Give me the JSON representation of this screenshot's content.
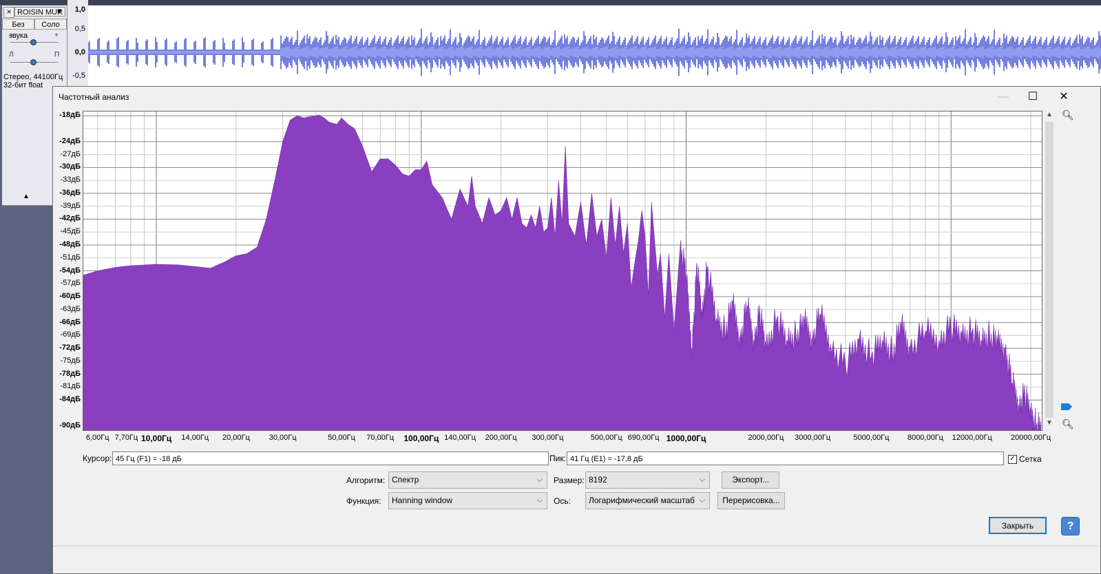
{
  "track": {
    "name": "ROISIN MUR",
    "mute_label": "Без звука",
    "solo_label": "Соло",
    "gain_minus": "–",
    "gain_plus": "+",
    "pan_left": "Л",
    "pan_right": "П",
    "info_line1": "Стерео, 44100Гц",
    "info_line2": "32-бит float",
    "scale_labels": [
      "1,0",
      "0,5",
      "0,0",
      "-0,5"
    ]
  },
  "dialog": {
    "title": "Частотный анализ",
    "y_labels": [
      "-18дБ",
      "-24дБ",
      "-27дБ",
      "-30дБ",
      "-33дБ",
      "-36дБ",
      "-39дБ",
      "-42дБ",
      "-45дБ",
      "-48дБ",
      "-51дБ",
      "-54дБ",
      "-57дБ",
      "-60дБ",
      "-63дБ",
      "-66дБ",
      "-69дБ",
      "-72дБ",
      "-75дБ",
      "-78дБ",
      "-81дБ",
      "-84дБ",
      "-90дБ"
    ],
    "x_labels": [
      "6,00Гц",
      "7,70Гц",
      "10,00Гц",
      "14,00Гц",
      "20,00Гц",
      "30,00Гц",
      "50,00Гц",
      "70,00Гц",
      "100,00Гц",
      "140,00Гц",
      "200,00Гц",
      "300,00Гц",
      "500,00Гц",
      "690,00Гц",
      "1000,00Гц",
      "2000,00Гц",
      "3000,00Гц",
      "5000,00Гц",
      "8000,00Гц",
      "12000,00Гц",
      "20000,00Гц"
    ],
    "cursor_label": "Курсор:",
    "cursor_value": "45 Гц (F1) = -18 дБ",
    "peak_label": "Пик:",
    "peak_value": "41 Гц (E1) = -17,8 дБ",
    "grid_label": "Сетка",
    "grid_checked": true,
    "algorithm_label": "Алгоритм:",
    "algorithm_value": "Спектр",
    "size_label": "Размер:",
    "size_value": "8192",
    "function_label": "Функция:",
    "function_value": "Hanning window",
    "axis_label": "Ось:",
    "axis_value": "Логарифмический масштаб",
    "export_button": "Экспорт...",
    "redraw_button": "Перерисовка...",
    "close_button": "Закрыть",
    "help_button": "?",
    "check_mark": "✓",
    "fill_color": "#8a3fc0",
    "accent_color": "#0078d7"
  },
  "chart_data": {
    "type": "area",
    "x_scale": "log",
    "xlim": [
      5.3,
      22000
    ],
    "ylim": [
      -91,
      -17
    ],
    "grid": true,
    "x": [
      5.3,
      6,
      7,
      8,
      10,
      12,
      14,
      16,
      18,
      20,
      22,
      24,
      26,
      28,
      30,
      32,
      34,
      36,
      38,
      40,
      41,
      43,
      45,
      48,
      50,
      53,
      56,
      60,
      65,
      70,
      75,
      80,
      85,
      90,
      95,
      100,
      105,
      110,
      120,
      130,
      140,
      150,
      155,
      160,
      170,
      180,
      190,
      200,
      210,
      220,
      230,
      240,
      250,
      260,
      270,
      280,
      290,
      300,
      310,
      320,
      330,
      340,
      350,
      360,
      380,
      400,
      420,
      440,
      460,
      480,
      500,
      520,
      540,
      560,
      580,
      600,
      620,
      640,
      660,
      680,
      700,
      720,
      740,
      760,
      780,
      800,
      830,
      860,
      900,
      950,
      1000,
      1050,
      1100,
      1150,
      1200,
      1300,
      1400,
      1500,
      1600,
      1700,
      1800,
      1900,
      2000,
      2200,
      2400,
      2600,
      2800,
      3000,
      3200,
      3500,
      4000,
      4500,
      5000,
      5500,
      6000,
      6500,
      7000,
      8000,
      9000,
      10000,
      11000,
      12000,
      13000,
      14000,
      15000,
      16000,
      17000,
      18000,
      19000,
      20000,
      21000,
      22000
    ],
    "values": [
      -55,
      -54,
      -53.2,
      -52.8,
      -52.5,
      -52.6,
      -53,
      -53.4,
      -52,
      -50.5,
      -50,
      -48.5,
      -42,
      -33,
      -24,
      -19,
      -18,
      -18.5,
      -18.2,
      -18,
      -17.8,
      -18.5,
      -19.5,
      -20,
      -18.5,
      -20,
      -21,
      -25,
      -31,
      -28,
      -28,
      -29.5,
      -31.5,
      -32,
      -30.5,
      -30.5,
      -28.5,
      -34,
      -37,
      -42,
      -35,
      -39,
      -32,
      -39,
      -43,
      -37,
      -41,
      -40,
      -37,
      -42,
      -37,
      -43,
      -44,
      -41,
      -44,
      -39,
      -45,
      -44,
      -37,
      -46,
      -33,
      -43,
      -25,
      -43,
      -46,
      -38,
      -48,
      -36,
      -46,
      -42,
      -51,
      -37,
      -48,
      -39,
      -50,
      -43,
      -58,
      -52,
      -47,
      -40,
      -46,
      -60,
      -38,
      -47,
      -55,
      -50,
      -65,
      -50,
      -68,
      -48,
      -55,
      -72,
      -53,
      -65,
      -53,
      -65,
      -68,
      -62,
      -70,
      -62,
      -70,
      -64,
      -72,
      -65,
      -70,
      -69,
      -66,
      -70,
      -64,
      -71,
      -76,
      -70,
      -74,
      -70,
      -73,
      -67,
      -72,
      -68,
      -70,
      -67,
      -69,
      -68,
      -70,
      -69,
      -71,
      -72,
      -80,
      -85,
      -83,
      -87,
      -90,
      -91
    ]
  }
}
